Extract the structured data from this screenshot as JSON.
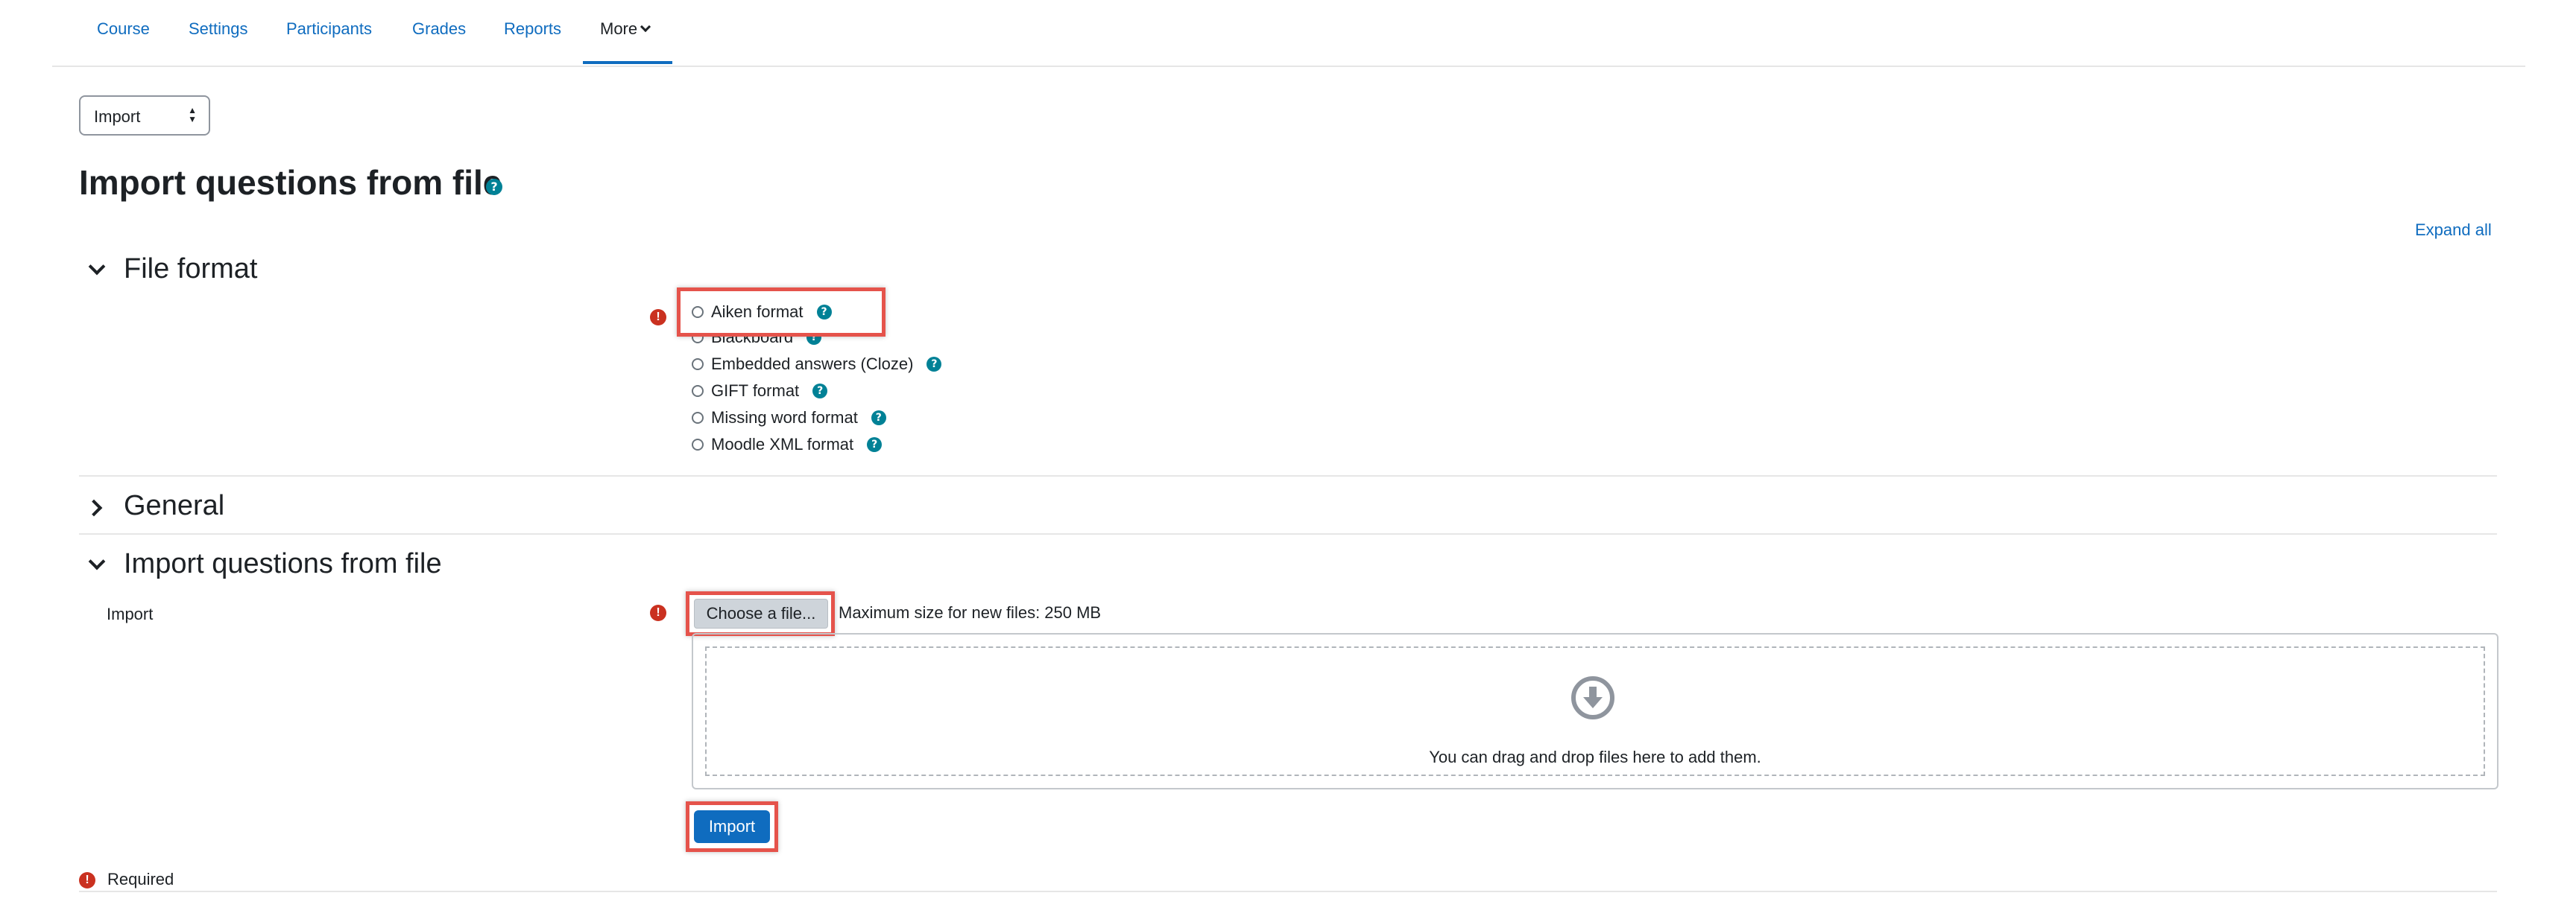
{
  "nav": {
    "items": [
      {
        "label": "Course"
      },
      {
        "label": "Settings"
      },
      {
        "label": "Participants"
      },
      {
        "label": "Grades"
      },
      {
        "label": "Reports"
      }
    ],
    "more_label": "More"
  },
  "action_select": {
    "value": "Import"
  },
  "page": {
    "title": "Import questions from file",
    "help_icon": "question-circle-icon"
  },
  "expand_all": "Expand all",
  "sections": {
    "file_format": {
      "title": "File format",
      "options": [
        {
          "label": "Aiken format",
          "help": true
        },
        {
          "label": "Blackboard",
          "help": true
        },
        {
          "label": "Embedded answers (Cloze)",
          "help": true
        },
        {
          "label": "GIFT format",
          "help": true
        },
        {
          "label": "Missing word format",
          "help": true
        },
        {
          "label": "Moodle XML format",
          "help": true
        }
      ]
    },
    "general": {
      "title": "General"
    },
    "import": {
      "title": "Import questions from file",
      "field_label": "Import",
      "choose_file": "Choose a file...",
      "max_size": "Maximum size for new files: 250 MB",
      "drop_text": "You can drag and drop files here to add them.",
      "submit": "Import"
    }
  },
  "required_text": "Required",
  "colors": {
    "link": "#0f6cbf",
    "primary": "#0f6cbf",
    "help": "#008196",
    "required": "#ca3120",
    "highlight": "#e5534b"
  }
}
